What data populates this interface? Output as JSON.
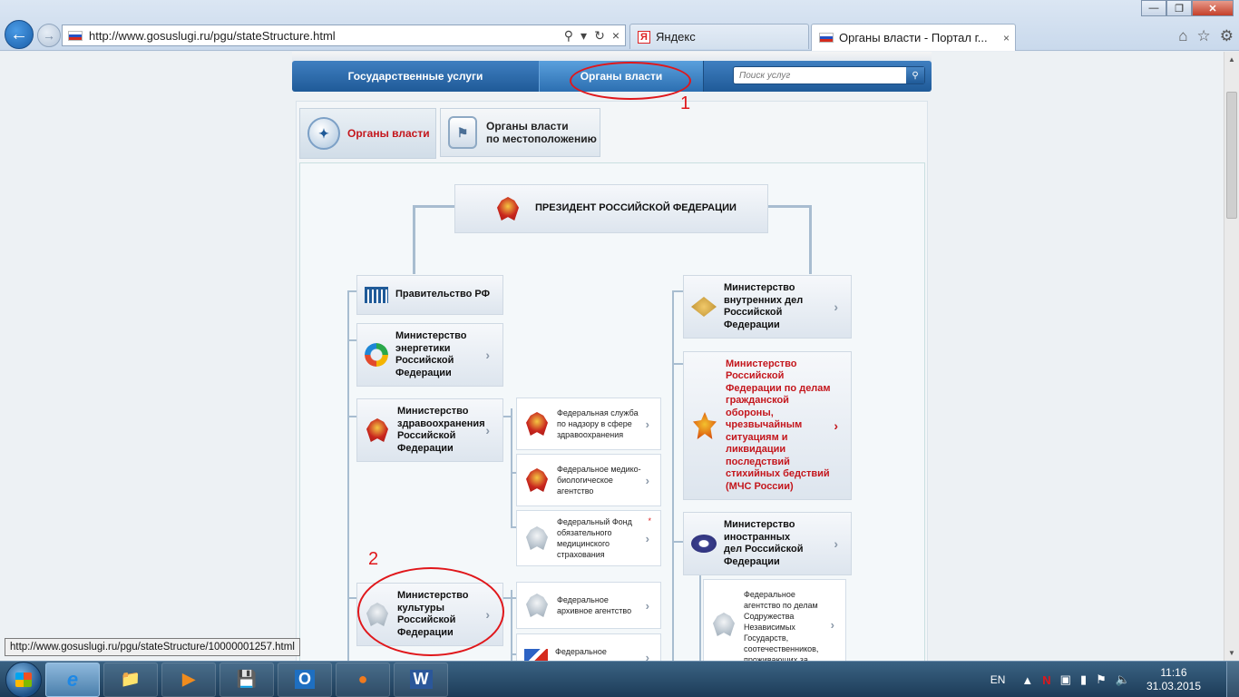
{
  "browser": {
    "address_url": "http://www.gosuslugi.ru/pgu/stateStructure.html",
    "tabs": [
      {
        "label": "Яндекс",
        "logo_letter": "Я"
      },
      {
        "label": "Органы власти - Портал г..."
      }
    ],
    "status_url": "http://www.gosuslugi.ru/pgu/stateStructure/10000001257.html"
  },
  "site": {
    "nav": {
      "services": "Государственные услуги",
      "organs": "Органы власти"
    },
    "search_placeholder": "Поиск услуг",
    "subtabs": {
      "organs": "Органы власти",
      "location_line1": "Органы власти",
      "location_line2": "по местоположению"
    }
  },
  "tree": {
    "president": "ПРЕЗИДЕНТ РОССИЙСКОЙ ФЕДЕРАЦИИ",
    "left": [
      {
        "title": "Правительство РФ",
        "icon": "government-building-icon"
      },
      {
        "title": "Министерство энергетики Российской Федерации",
        "icon": "energy-ministry-icon"
      },
      {
        "title": "Министерство здравоохранения Российской Федерации",
        "icon": "coat-of-arms-icon"
      },
      {
        "title": "Министерство культуры Российской Федерации",
        "icon": "coat-of-arms-grey-icon"
      }
    ],
    "health_subs": [
      "Федеральная служба по надзору в сфере здравоохранения",
      "Федеральное медико-биологическое агентство",
      "Федеральный Фонд обязательного медицинского страхования"
    ],
    "health_subs_star": "*",
    "culture_subs": [
      "Федеральное архивное агентство",
      "Федеральное агентство по туризму"
    ],
    "right": [
      {
        "title": "Министерство внутренних дел Российской Федерации",
        "icon": "mvd-emblem-icon"
      },
      {
        "title": "Министерство Российской Федерации по делам гражданской обороны, чрезвычайным ситуациям и ликвидации последствий стихийных бедствий (МЧС России)",
        "icon": "mchs-emblem-icon"
      },
      {
        "title": "Министерство иностранных дел Российской Федерации",
        "icon": "mid-emblem-icon"
      }
    ],
    "mid_sub": "Федеральное агентство по делам Содружества Независимых Государств, соотечественников, проживающих за"
  },
  "annotations": {
    "mark1": "1",
    "mark2": "2"
  },
  "taskbar": {
    "lang": "EN",
    "time": "11:16",
    "date": "31.03.2015",
    "apps": [
      "ie-icon",
      "file-explorer-icon",
      "media-player-icon",
      "save-icon",
      "outlook-icon",
      "foxit-icon",
      "word-icon"
    ]
  },
  "colors": {
    "accent_blue": "#1f5a98",
    "brand_red": "#c4161c",
    "annotation_red": "#e0171b"
  }
}
